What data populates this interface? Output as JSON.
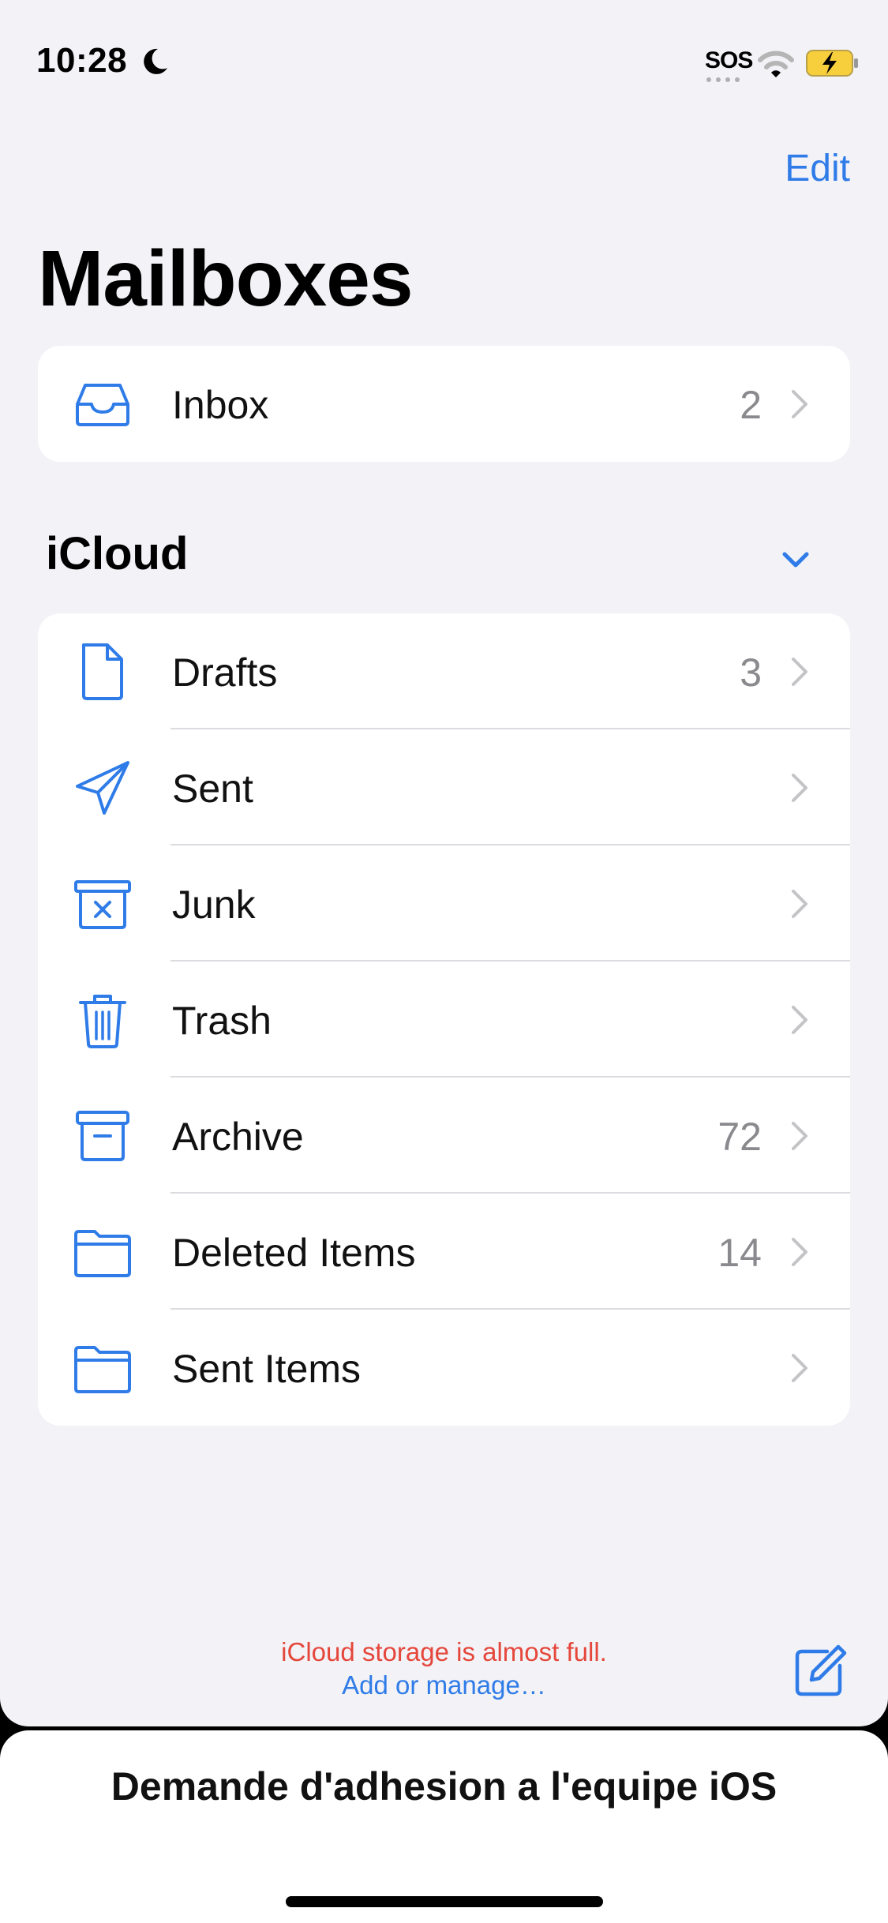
{
  "status_bar": {
    "time": "10:28",
    "sos": "SOS"
  },
  "nav": {
    "edit_label": "Edit",
    "title": "Mailboxes"
  },
  "inbox": {
    "label": "Inbox",
    "count": "2"
  },
  "section": {
    "title": "iCloud"
  },
  "mailboxes": [
    {
      "label": "Drafts",
      "count": "3",
      "icon": "doc-icon"
    },
    {
      "label": "Sent",
      "count": "",
      "icon": "paperplane-icon"
    },
    {
      "label": "Junk",
      "count": "",
      "icon": "junk-icon"
    },
    {
      "label": "Trash",
      "count": "",
      "icon": "trash-icon"
    },
    {
      "label": "Archive",
      "count": "72",
      "icon": "archive-icon"
    },
    {
      "label": "Deleted Items",
      "count": "14",
      "icon": "folder-icon"
    },
    {
      "label": "Sent Items",
      "count": "",
      "icon": "folder-icon"
    }
  ],
  "footer": {
    "storage_warning": "iCloud storage is almost full.",
    "storage_link": "Add or manage…"
  },
  "sheet": {
    "title": "Demande d'adhesion a l'equipe iOS"
  },
  "colors": {
    "accent": "#2f7ce8",
    "warning": "#e5473b",
    "background": "#f2f2f7"
  }
}
